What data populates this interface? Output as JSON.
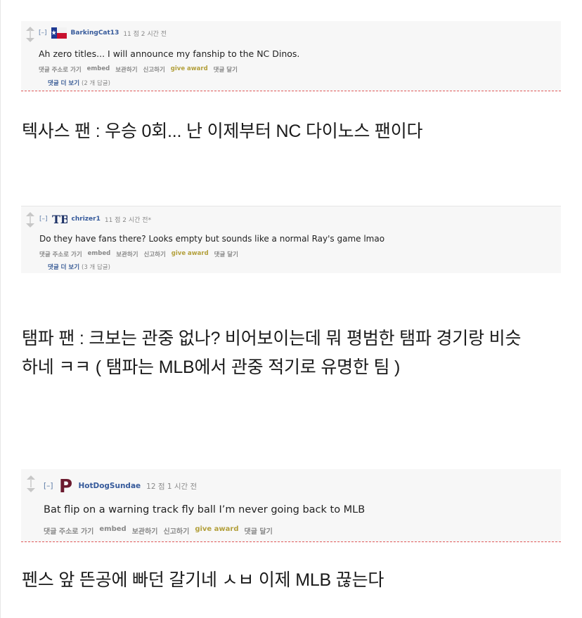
{
  "comments": [
    {
      "toggle": "[–]",
      "author": "BarkingCat13",
      "meta": "11 점 2 시간 전",
      "flair_icon": "texas-flag-icon",
      "body": "Ah zero titles... I will announce my fanship to the NC Dinos.",
      "actions": [
        "댓글 주소로 가기",
        "embed",
        "보관하기",
        "신고하기",
        "give award",
        "댓글 달기"
      ],
      "more_label": "댓글 더 보기",
      "more_count": "(2 개 답글)"
    },
    {
      "toggle": "[–]",
      "author": "chrizer1",
      "meta": "11 점 2 시간 전*",
      "flair_icon": "tampa-bay-rays-logo-icon",
      "flair_text": "TB",
      "body": "Do they have fans there? Looks empty but sounds like a normal Ray's game lmao",
      "actions": [
        "댓글 주소로 가기",
        "embed",
        "보관하기",
        "신고하기",
        "give award",
        "댓글 달기"
      ],
      "more_label": "댓글 더 보기",
      "more_count": "(3 개 답글)"
    },
    {
      "toggle": "[–]",
      "author": "HotDogSundae",
      "meta": "12 점 1 시간 전",
      "flair_icon": "phillies-p-logo-icon",
      "flair_text": "P",
      "body": "Bat flip on a warning track fly ball I’m never going back to MLB",
      "actions": [
        "댓글 주소로 가기",
        "embed",
        "보관하기",
        "신고하기",
        "give award",
        "댓글 달기"
      ]
    }
  ],
  "captions": {
    "c1": "텍사스 팬 : 우승 0회... 난 이제부터 NC 다이노스 팬이다",
    "c2_line1": "탬파 팬 : 크보는 관중 없나? 비어보이는데 뭐 평범한 탬파 경기랑 비슷",
    "c2_line2": "하네 ㅋㅋ ( 탬파는 MLB에서 관중 적기로 유명한 팀 )",
    "c3": "펜스 앞 뜬공에 빠던 갈기네 ㅅㅂ 이제 MLB 끊는다"
  },
  "colors": {
    "author": "#365a9b",
    "award": "#b3a03c",
    "dashed_border": "#e05a5a",
    "phillies": "#6b1a2e"
  }
}
